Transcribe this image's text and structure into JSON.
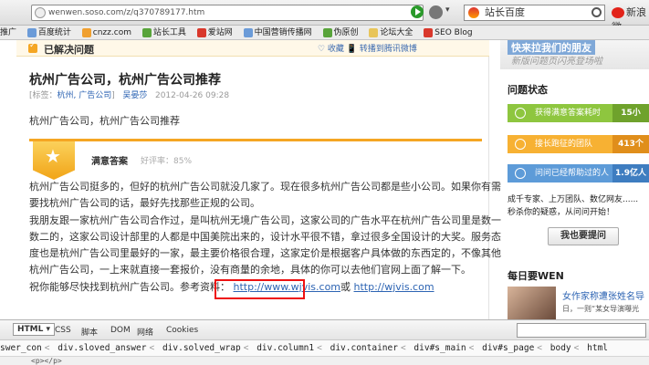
{
  "browser": {
    "url": "wenwen.soso.com/z/q370789177.htm",
    "search_engine": "站长百度",
    "weibo": "新浪微",
    "bookmarks": [
      "推广",
      "百度统计",
      "cnzz.com",
      "站长工具",
      "爱站网",
      "中国营销传播网",
      "伪原创",
      "论坛大全",
      "SEO Blog"
    ]
  },
  "page": {
    "solved_label": "已解决问题",
    "actions": "♡ 收藏  📱 转播到腾讯微博",
    "title": "杭州广告公司，杭州广告公司推荐",
    "meta_prefix": "[标签：",
    "tags": "杭州, 广告公司",
    "meta_suffix": "]",
    "author": "吴晏莎",
    "date": "2012-04-26 09:28",
    "question_body": "杭州广告公司，杭州广告公司推荐",
    "answer_header": "满意答案",
    "praise_rate": "好评率：85%",
    "answer_lines": [
      "杭州广告公司挺多的，但好的杭州广告公司就没几家了。现在很多杭州广告公司都是些小公司。如果你有需",
      "要找杭州广告公司的话，最好先找那些正规的公司。",
      "我朋友跟一家杭州广告公司合作过，是叫杭州无境广告公司，这家公司的广告水平在杭州广告公司里是数一",
      "数二的，这家公司设计部里的人都是中国美院出来的，设计水平很不错，拿过很多全国设计的大奖。服务态",
      "度也是杭州广告公司里最好的一家，最主要价格很合理，这家定价是根据客户具体做的东西定的，不像其他",
      "杭州广告公司，一上来就直接一套报价，没有商量的余地，具体的你可以去他们官网上面了解一下。"
    ],
    "ref_prefix": "祝你能够尽快找到杭州广告公司。参考资料：",
    "link1": "http://www.wjvis.com",
    "link_joiner": "或",
    "link2": "http://wjvis.com"
  },
  "sidebar": {
    "banner_line1": "快来拉我们的朋友",
    "banner_line2": "新版问题页闪亮登场啦",
    "status_title": "问题状态",
    "stats": [
      {
        "label": "获得满意答案耗时",
        "value": "15小"
      },
      {
        "label": "接长跑征的团队",
        "value": "413个"
      },
      {
        "label": "问问已经帮助过的人",
        "value": "1.9亿人"
      }
    ],
    "promo_line1": "成千专家、上万团队、数亿网友......",
    "promo_line2": "秒杀你的疑惑，从问问开始！",
    "ask_button": "我也要提问",
    "daily_title": "每日要WEN",
    "daily_item1": "女作家称遭张姓名导",
    "daily_item2": "日，一则“某女导演曝光"
  },
  "devtools": {
    "tab_html": "HTML ▾",
    "tabs": [
      "CSS",
      "脚本",
      "DOM",
      "网络",
      "Cookies"
    ],
    "breadcrumb": [
      "swer_con",
      "div.sloved_answer",
      "div.solved_wrap",
      "div.column1",
      "div.container",
      "div#s_main",
      "div#s_page",
      "body",
      "html"
    ],
    "source_line": "<p></p>"
  },
  "colors": {
    "accent": "#f5a623",
    "link": "#2d64b3",
    "highlight_box": "#ee1111"
  }
}
